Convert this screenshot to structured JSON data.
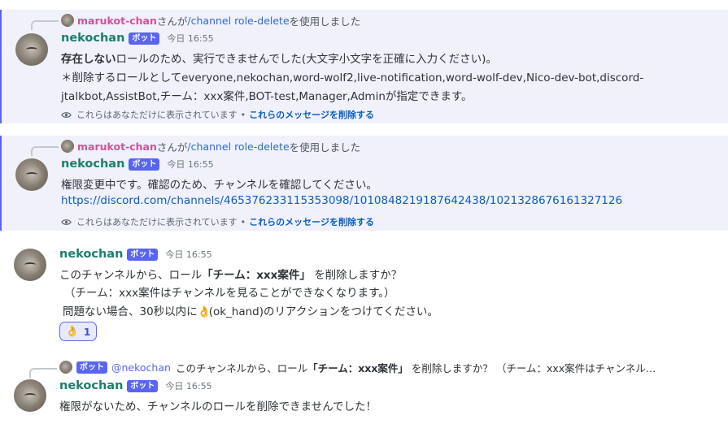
{
  "messages": [
    {
      "reference": {
        "user": "marukot-chan",
        "text_mid": "さんが",
        "command": "/channel role-delete",
        "text_end": "を使用しました"
      },
      "author": "nekochan",
      "bot_label": "ボット",
      "time": "今日 16:55",
      "line1_bold": "存在しない",
      "line1_rest": "ロールのため、実行できませんでした(大文字小文字を正確に入力ください)。",
      "line2": "＊削除するロールとしてeveryone,nekochan,word-wolf2,live-notification,word-wolf-dev,Nico-dev-bot,discord-",
      "line3": "jtalkbot,AssistBot,チーム：xxx案件,BOT-test,Manager,Adminが指定できます。",
      "ephemeral_note": "これらはあなただけに表示されています",
      "ephemeral_separator": "•",
      "ephemeral_delete": "これらのメッセージを削除する"
    },
    {
      "reference": {
        "user": "marukot-chan",
        "text_mid": "さんが",
        "command": "/channel role-delete",
        "text_end": "を使用しました"
      },
      "author": "nekochan",
      "bot_label": "ボット",
      "time": "今日 16:55",
      "line1": "権限変更中です。確認のため、チャンネルを確認してください。",
      "link": "https://discord.com/channels/465376233115353098/1010848219187642438/1021328676161327126",
      "ephemeral_note": "これらはあなただけに表示されています",
      "ephemeral_separator": "•",
      "ephemeral_delete": "これらのメッセージを削除する"
    },
    {
      "author": "nekochan",
      "bot_label": "ボット",
      "time": "今日 16:55",
      "line1_pre": "このチャンネルから、ロール",
      "line1_bold": "「チーム：xxx案件」",
      "line1_post": " を削除しますか？",
      "line2": "（チーム：xxx案件はチャンネルを見ることができなくなります。）",
      "line3_pre": "問題ない場合、30秒以内に",
      "line3_emoji": "👌",
      "line3_post": "(ok_hand)のリアクションをつけてください。",
      "reaction": {
        "emoji": "👌",
        "count": "1"
      }
    },
    {
      "reference": {
        "bot_label": "ボット",
        "mention": "@nekochan",
        "text_pre": "このチャンネルから、ロール",
        "text_bold": "「チーム：xxx案件」",
        "text_post": " を削除しますか？ （チーム：xxx案件はチャンネル…"
      },
      "author": "nekochan",
      "bot_label": "ボット",
      "time": "今日 16:55",
      "line1": "権限がないため、チャンネルのロールを削除できませんでした！"
    }
  ],
  "colors": {
    "accent": "#5865f2",
    "link": "#0b5fc1",
    "author": "#1a7f6e",
    "ref_user": "#d4509a",
    "ephemeral_bg": "#f0f1fb"
  },
  "icons": {
    "eye": "eye-icon",
    "mini_avatar": "avatar",
    "avatar": "avatar"
  }
}
